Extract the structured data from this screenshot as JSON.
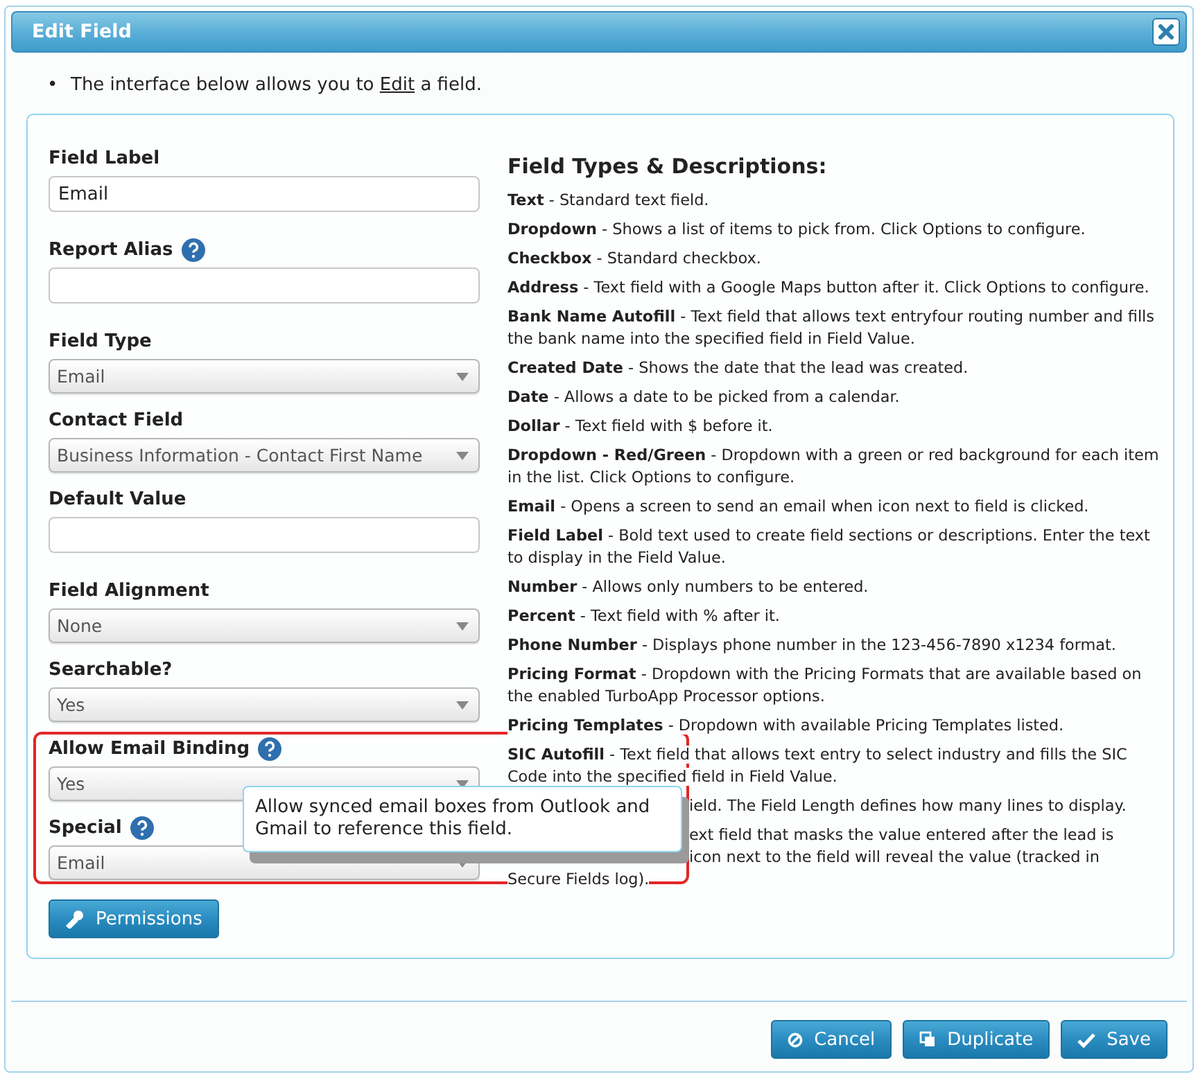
{
  "dialog": {
    "title": "Edit Field"
  },
  "intro": {
    "bullet": "•",
    "before": "The interface below allows you to ",
    "link": "Edit",
    "after": " a field."
  },
  "fields": [
    {
      "label": "Field Label",
      "kind": "text",
      "value": "Email",
      "help": false
    },
    {
      "label": "Report Alias",
      "kind": "text",
      "help": true
    },
    {
      "label": "Field Type",
      "kind": "select",
      "value": "Email",
      "help": false
    },
    {
      "label": "Contact Field",
      "kind": "select",
      "value": "Business Information - Contact First Name",
      "help": false
    },
    {
      "label": "Default Value",
      "kind": "text",
      "help": false
    },
    {
      "label": "Field Alignment",
      "kind": "select",
      "value": "None",
      "help": false
    },
    {
      "label": "Searchable?",
      "kind": "select",
      "value": "Yes",
      "help": false
    }
  ],
  "highlighted_fields": [
    {
      "label": "Allow Email Binding",
      "kind": "select",
      "value": "Yes",
      "help": true
    },
    {
      "label": "Special",
      "kind": "select",
      "value": "Email",
      "help": true
    }
  ],
  "tooltip": {
    "text": "Allow synced email boxes from Outlook and Gmail to reference this field."
  },
  "permissions_button": {
    "label": "Permissions"
  },
  "descriptions": {
    "heading": "Field Types & Descriptions:",
    "items": [
      {
        "kind": "full",
        "text": "**Text** - Standard text field."
      },
      {
        "kind": "full",
        "text": "**Dropdown** - Shows a list of items to pick from. Click Options to configure."
      },
      {
        "kind": "full",
        "text": "**Checkbox** - Standard checkbox."
      },
      {
        "kind": "full",
        "text": "**Address** - Text field with a Google Maps button after it. Click Options to configure."
      },
      {
        "kind": "full",
        "text": "**Bank Name Autofill** - Text field that allows text entryfour routing number and fills the bank name into the specified field in Field Value."
      },
      {
        "kind": "full",
        "text": "**Created Date** - Shows the date that the lead was created."
      },
      {
        "kind": "full",
        "text": "**Date** - Allows a date to be picked from a calendar."
      },
      {
        "kind": "full",
        "text": "**Dollar** - Text field with $ before it."
      },
      {
        "kind": "full",
        "text": "**Dropdown - Red/Green** - Dropdown with a green or red background for each item in the list. Click Options to configure."
      },
      {
        "kind": "full",
        "text": "**Email** - Opens a screen to send an email when icon next to field is clicked."
      },
      {
        "kind": "full",
        "text": "**Field Label** - Bold text used to create field sections or descriptions. Enter the text to display in the Field Value."
      },
      {
        "kind": "full",
        "text": "**Number** - Allows only numbers to be entered."
      },
      {
        "kind": "full",
        "text": "**Percent** - Text field with % after it."
      },
      {
        "kind": "full",
        "text": "**Phone Number** - Displays phone number in the 123-456-7890 x1234 format."
      },
      {
        "kind": "full",
        "text": "**Pricing Format** - Dropdown with the Pricing Formats that are available based on the enabled TurboApp Processor options."
      },
      {
        "kind": "full",
        "text": "**Pricing Templates** - Dropdown with available Pricing Templates listed."
      },
      {
        "kind": "full",
        "text": "**SIC Autofill** - Text field that allows text entry to select industry and fills the SIC Code into the specified field in Field Value."
      },
      {
        "kind": "covered",
        "lines": [
          "ield. The Field Length defines how many lines to display."
        ]
      },
      {
        "kind": "covered",
        "lines": [
          "ext field that masks the value entered after the lead is",
          "icon next to the field will reveal the value (tracked in"
        ],
        "tail": "Secure Fields log)."
      }
    ]
  },
  "footer_buttons": [
    {
      "label": "Cancel"
    },
    {
      "label": "Duplicate"
    },
    {
      "label": "Save"
    }
  ]
}
